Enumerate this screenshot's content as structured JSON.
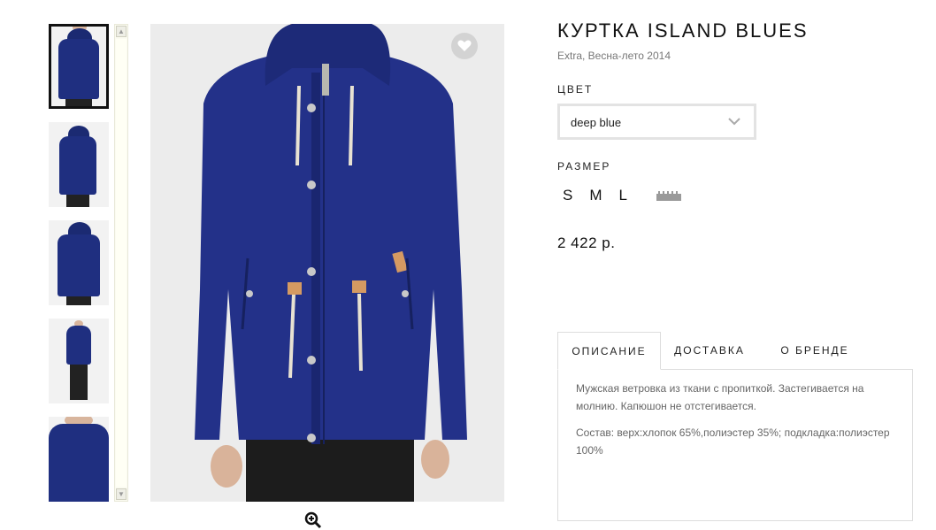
{
  "product": {
    "title": "КУРТКА ISLAND BLUES",
    "subtitle": "Extra, Весна-лето 2014",
    "color_label": "ЦВЕТ",
    "color_value": "deep blue",
    "size_label": "РАЗМЕР",
    "sizes": [
      "S",
      "M",
      "L"
    ],
    "price": "2 422 р."
  },
  "tabs": [
    {
      "label": "ОПИСАНИЕ",
      "active": true
    },
    {
      "label": "ДОСТАВКА",
      "active": false
    },
    {
      "label": "О БРЕНДЕ",
      "active": false
    }
  ],
  "description": {
    "text": "Мужская ветровка из ткани с пропиткой. Застегивается на молнию. Капюшон не отстегивается.",
    "composition": "Состав: верх:хлопок 65%,полиэстер 35%; подкладка:полиэстер 100%"
  },
  "icons": {
    "favorite": "heart-icon",
    "zoom": "zoom-in-icon",
    "size_chart": "ruler-icon",
    "dropdown": "chevron-down-icon"
  },
  "colors": {
    "jacket": "#1f2f80",
    "favorite_bg": "#d3d3d3"
  }
}
